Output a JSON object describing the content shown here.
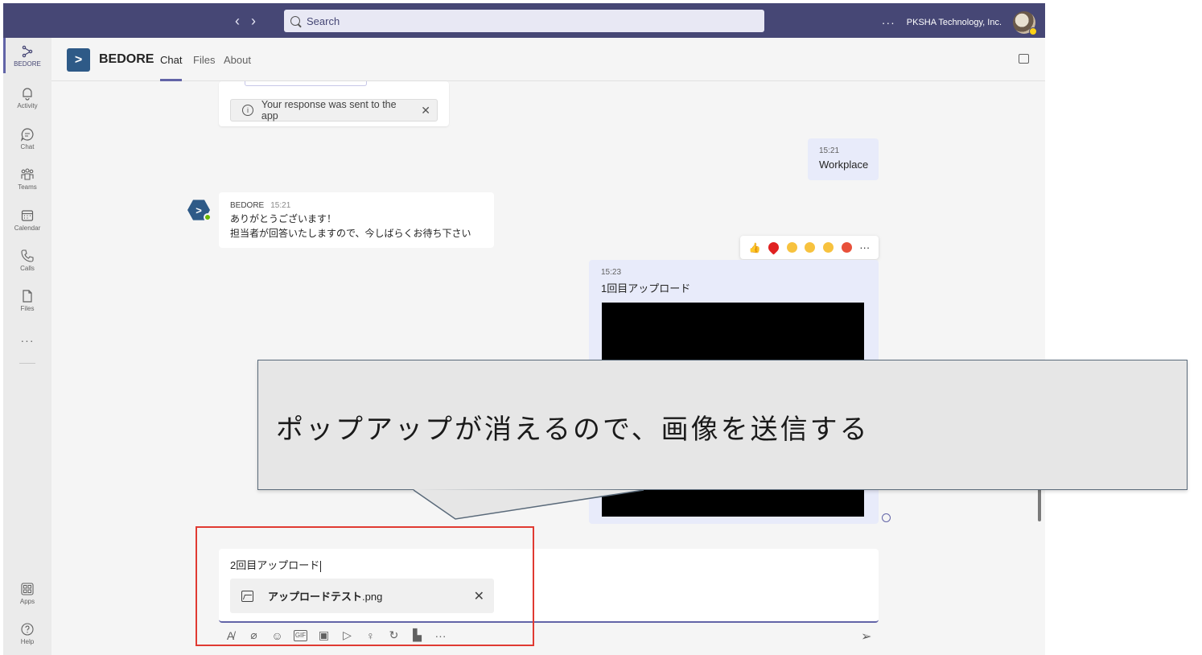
{
  "topbar": {
    "back": "‹",
    "forward": "›",
    "search_placeholder": "Search",
    "more": "···",
    "org_name": "PKSHA Technology, Inc."
  },
  "rail": {
    "items": [
      {
        "label": "BEDORE",
        "icon": "bedore-app-icon"
      },
      {
        "label": "Activity",
        "icon": "bell-icon"
      },
      {
        "label": "Chat",
        "icon": "chat-bubble-icon"
      },
      {
        "label": "Teams",
        "icon": "teams-icon"
      },
      {
        "label": "Calendar",
        "icon": "calendar-icon"
      },
      {
        "label": "Calls",
        "icon": "phone-icon"
      },
      {
        "label": "Files",
        "icon": "file-icon"
      }
    ],
    "more": "···",
    "apps": "Apps",
    "help": "Help"
  },
  "header": {
    "app_name": "BEDORE",
    "tabs": [
      "Chat",
      "Files",
      "About"
    ]
  },
  "messages": {
    "response_notice": "Your response was sent to the app",
    "me1": {
      "time": "15:21",
      "text": "Workplace"
    },
    "bot": {
      "name": "BEDORE",
      "time": "15:21",
      "line1": "ありがとうございます！",
      "line2": "担当者が回答いたしますので、今しばらくお待ち下さい"
    },
    "me2": {
      "time": "15:23",
      "text": "1回目アップロード"
    }
  },
  "reactions": [
    "like",
    "heart",
    "laugh",
    "surprised",
    "sad",
    "angry"
  ],
  "compose": {
    "text": "2回目アップロード",
    "attachment_name": "アップロードテスト",
    "attachment_ext": ".png"
  },
  "annotation": {
    "callout_text": "ポップアップが消えるので、画像を送信する",
    "frame_color": "#e03a32"
  },
  "colors": {
    "topbar": "#464775",
    "accent": "#6264a7",
    "brand": "#2e5a87",
    "my_bubble": "#e8ebfa"
  }
}
